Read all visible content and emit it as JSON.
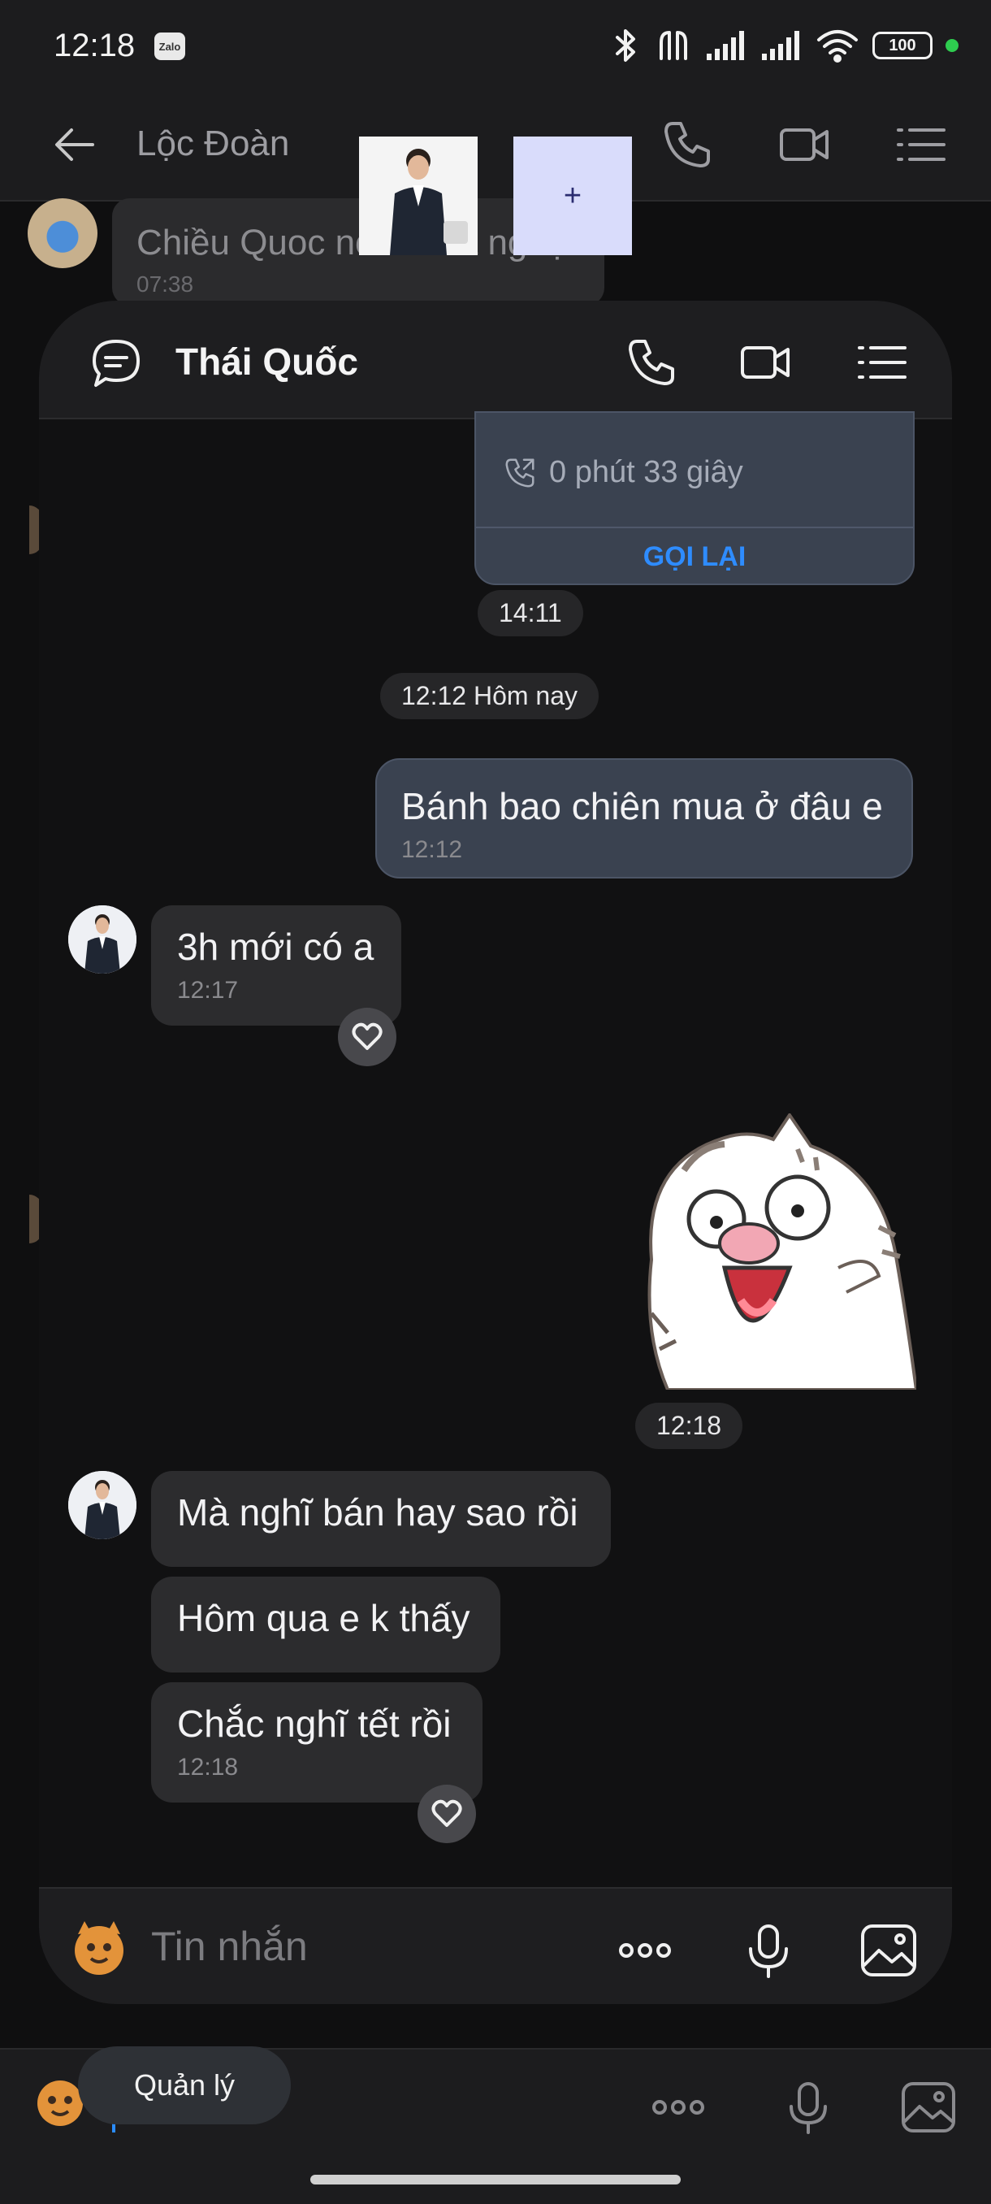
{
  "status_bar": {
    "time": "12:18",
    "app_badge": "Zalo",
    "battery": "100"
  },
  "background_chat": {
    "title": "Lộc Đoàn",
    "last_message": {
      "text": "Chiều Quoc nó ở nhà ngoại",
      "time": "07:38"
    }
  },
  "floating": {
    "add_label": "+"
  },
  "bubble": {
    "contact_name": "Thái Quốc",
    "call_card": {
      "duration": "0 phút 33 giây",
      "action": "GỌI LẠI"
    },
    "time_1411": "14:11",
    "date_separator": "12:12 Hôm nay",
    "messages": [
      {
        "dir": "out",
        "text": "Bánh bao chiên mua ở đâu e",
        "time": "12:12"
      },
      {
        "dir": "in",
        "text": "3h mới có a",
        "time": "12:17"
      },
      {
        "dir": "out",
        "sticker": "cat-shocked-sticker"
      },
      {
        "dir": "in",
        "text": "Mà nghĩ bán hay sao rồi"
      },
      {
        "dir": "in",
        "text": "Hôm qua e k thấy"
      },
      {
        "dir": "in",
        "text": "Chắc nghĩ tết rồi",
        "time": "12:18"
      }
    ],
    "sticker_time": "12:18",
    "composer_placeholder": "Tin nhắn"
  },
  "bottom": {
    "manage_chip": "Quản lý"
  },
  "icons": {
    "back": "arrow-left-icon",
    "phone": "phone-icon",
    "video": "video-icon",
    "menu": "list-menu-icon",
    "chat": "chat-bubble-icon",
    "more": "more-dots-icon",
    "mic": "microphone-icon",
    "image": "image-icon",
    "heart": "heart-icon"
  },
  "colors": {
    "accent": "#2E8CFF",
    "outgoing_bubble": "#3A4250",
    "incoming_bubble": "#2C2C2E"
  }
}
